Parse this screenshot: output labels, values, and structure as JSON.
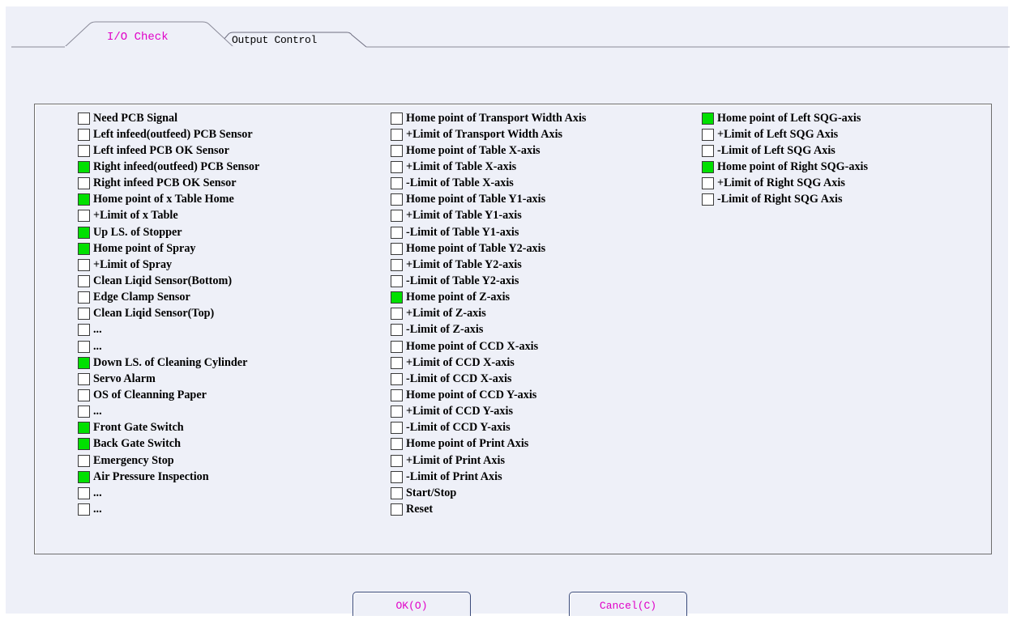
{
  "tabs": [
    {
      "label": "I/O Check",
      "active": true
    },
    {
      "label": "Output Control",
      "active": false
    }
  ],
  "colors": {
    "on": "#00e000",
    "accent": "#e000c8"
  },
  "columns": [
    [
      {
        "label": "Need PCB Signal",
        "on": false
      },
      {
        "label": "Left infeed(outfeed) PCB Sensor",
        "on": false
      },
      {
        "label": "Left infeed PCB OK Sensor",
        "on": false
      },
      {
        "label": "Right infeed(outfeed) PCB Sensor",
        "on": true
      },
      {
        "label": "Right infeed PCB OK Sensor",
        "on": false
      },
      {
        "label": "Home point of x Table Home",
        "on": true
      },
      {
        "label": "+Limit of x Table",
        "on": false
      },
      {
        "label": "Up LS. of Stopper",
        "on": true
      },
      {
        "label": "Home point of Spray",
        "on": true
      },
      {
        "label": "+Limit of Spray",
        "on": false
      },
      {
        "label": "Clean Liqid Sensor(Bottom)",
        "on": false
      },
      {
        "label": "Edge Clamp Sensor",
        "on": false
      },
      {
        "label": "Clean Liqid Sensor(Top)",
        "on": false
      },
      {
        "label": "...",
        "on": false
      },
      {
        "label": "...",
        "on": false
      },
      {
        "label": "Down LS. of Cleaning Cylinder",
        "on": true
      },
      {
        "label": "Servo Alarm",
        "on": false
      },
      {
        "label": "OS of Cleanning Paper",
        "on": false
      },
      {
        "label": "...",
        "on": false
      },
      {
        "label": "Front Gate Switch",
        "on": true
      },
      {
        "label": "Back Gate Switch",
        "on": true
      },
      {
        "label": "Emergency Stop",
        "on": false
      },
      {
        "label": "Air Pressure Inspection",
        "on": true
      },
      {
        "label": "...",
        "on": false
      },
      {
        "label": "...",
        "on": false
      }
    ],
    [
      {
        "label": "Home point of Transport Width Axis",
        "on": false
      },
      {
        "label": "+Limit of Transport Width Axis",
        "on": false
      },
      {
        "label": "Home point of Table X-axis",
        "on": false
      },
      {
        "label": "+Limit of Table X-axis",
        "on": false
      },
      {
        "label": "-Limit of Table X-axis",
        "on": false
      },
      {
        "label": "Home point of Table Y1-axis",
        "on": false
      },
      {
        "label": "+Limit of Table Y1-axis",
        "on": false
      },
      {
        "label": "-Limit of Table Y1-axis",
        "on": false
      },
      {
        "label": "Home point of Table Y2-axis",
        "on": false
      },
      {
        "label": "+Limit of Table Y2-axis",
        "on": false
      },
      {
        "label": "-Limit of Table Y2-axis",
        "on": false
      },
      {
        "label": "Home point of Z-axis",
        "on": true
      },
      {
        "label": "+Limit of Z-axis",
        "on": false
      },
      {
        "label": "-Limit of Z-axis",
        "on": false
      },
      {
        "label": "Home point of CCD X-axis",
        "on": false
      },
      {
        "label": "+Limit of CCD X-axis",
        "on": false
      },
      {
        "label": "-Limit of CCD X-axis",
        "on": false
      },
      {
        "label": "Home point of CCD Y-axis",
        "on": false
      },
      {
        "label": "+Limit of CCD Y-axis",
        "on": false
      },
      {
        "label": "-Limit of CCD Y-axis",
        "on": false
      },
      {
        "label": "Home point of Print Axis",
        "on": false
      },
      {
        "label": "+Limit of Print Axis",
        "on": false
      },
      {
        "label": "-Limit of Print Axis",
        "on": false
      },
      {
        "label": "Start/Stop",
        "on": false
      },
      {
        "label": "Reset",
        "on": false
      }
    ],
    [
      {
        "label": "Home point of Left SQG-axis",
        "on": true
      },
      {
        "label": "+Limit of Left SQG Axis",
        "on": false
      },
      {
        "label": "-Limit of Left SQG Axis",
        "on": false
      },
      {
        "label": "Home point of Right SQG-axis",
        "on": true
      },
      {
        "label": "+Limit of Right SQG Axis",
        "on": false
      },
      {
        "label": "-Limit of Right SQG Axis",
        "on": false
      }
    ]
  ],
  "buttons": {
    "ok": "OK(O)",
    "cancel": "Cancel(C)"
  }
}
